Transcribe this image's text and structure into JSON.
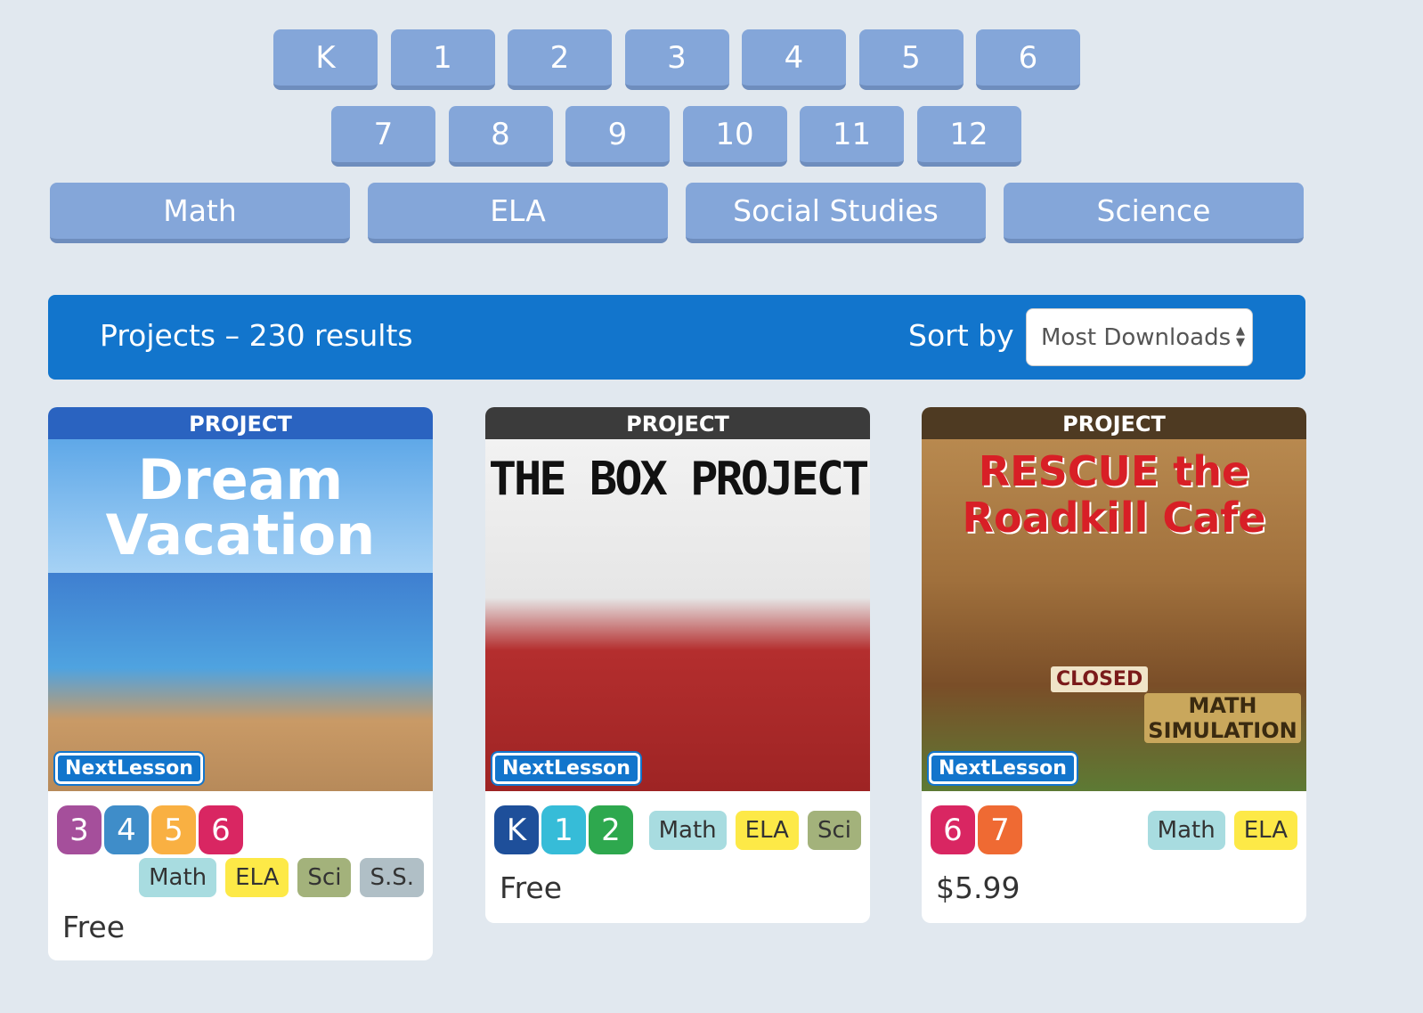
{
  "grades_row1": [
    "K",
    "1",
    "2",
    "3",
    "4",
    "5",
    "6"
  ],
  "grades_row2": [
    "7",
    "8",
    "9",
    "10",
    "11",
    "12"
  ],
  "subjects": [
    "Math",
    "ELA",
    "Social Studies",
    "Science"
  ],
  "results_bar": {
    "title": "Projects – 230 results",
    "sort_label": "Sort by",
    "sort_value": "Most Downloads"
  },
  "colors": {
    "accent": "#1275cc",
    "filter_button": "#84a6d9"
  },
  "cards": [
    {
      "tag": "PROJECT",
      "image_title": "Dream Vacation",
      "brand": "NextLesson",
      "grades": [
        "3",
        "4",
        "5",
        "6"
      ],
      "subjects": [
        "Math",
        "ELA",
        "Sci",
        "S.S."
      ],
      "price": "Free"
    },
    {
      "tag": "PROJECT",
      "image_title": "THE BOX PROJECT",
      "brand": "NextLesson",
      "grades": [
        "K",
        "1",
        "2"
      ],
      "subjects": [
        "Math",
        "ELA",
        "Sci"
      ],
      "price": "Free"
    },
    {
      "tag": "PROJECT",
      "image_title": "RESCUE the Roadkill Cafe",
      "image_subtitle": "MATH SIMULATION",
      "image_sign": "CLOSED",
      "brand": "NextLesson",
      "grades": [
        "6",
        "7"
      ],
      "subjects": [
        "Math",
        "ELA"
      ],
      "price": "$5.99"
    }
  ]
}
